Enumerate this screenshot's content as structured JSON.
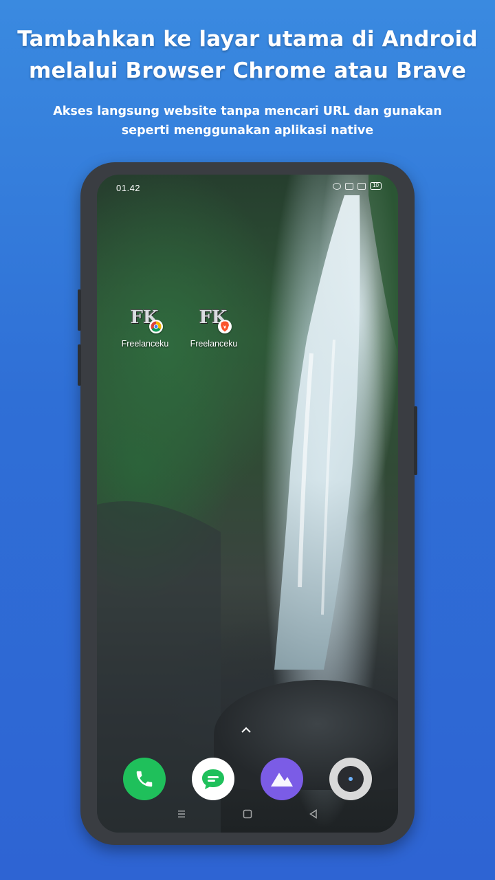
{
  "header": {
    "title_line1": "Tambahkan ke layar utama di Android",
    "title_line2": "melalui Browser Chrome atau Brave",
    "subtitle_line1": "Akses langsung website tanpa mencari URL dan gunakan",
    "subtitle_line2": "seperti menggunakan aplikasi native"
  },
  "phone": {
    "status_bar": {
      "time": "01.42",
      "battery": "10",
      "icons": [
        "alarm-icon",
        "signal-icon",
        "wifi-icon",
        "battery-icon"
      ]
    },
    "home_shortcuts": [
      {
        "label": "Freelanceku",
        "logo_text": "FK",
        "browser": "chrome-badge-icon"
      },
      {
        "label": "Freelanceku",
        "logo_text": "FK",
        "browser": "brave-badge-icon"
      }
    ],
    "dock": [
      {
        "name": "phone-icon",
        "color": "#1fc05b"
      },
      {
        "name": "messages-icon",
        "color": "#ffffff"
      },
      {
        "name": "gallery-icon",
        "color": "#7b5ce6"
      },
      {
        "name": "camera-icon",
        "color": "#d9d9d9"
      }
    ],
    "nav_bar": [
      "menu-icon",
      "home-icon",
      "back-icon"
    ]
  },
  "colors": {
    "background_top": "#3a8ae0",
    "background_bottom": "#2e64d3",
    "phone_frame": "#3a3d42"
  }
}
